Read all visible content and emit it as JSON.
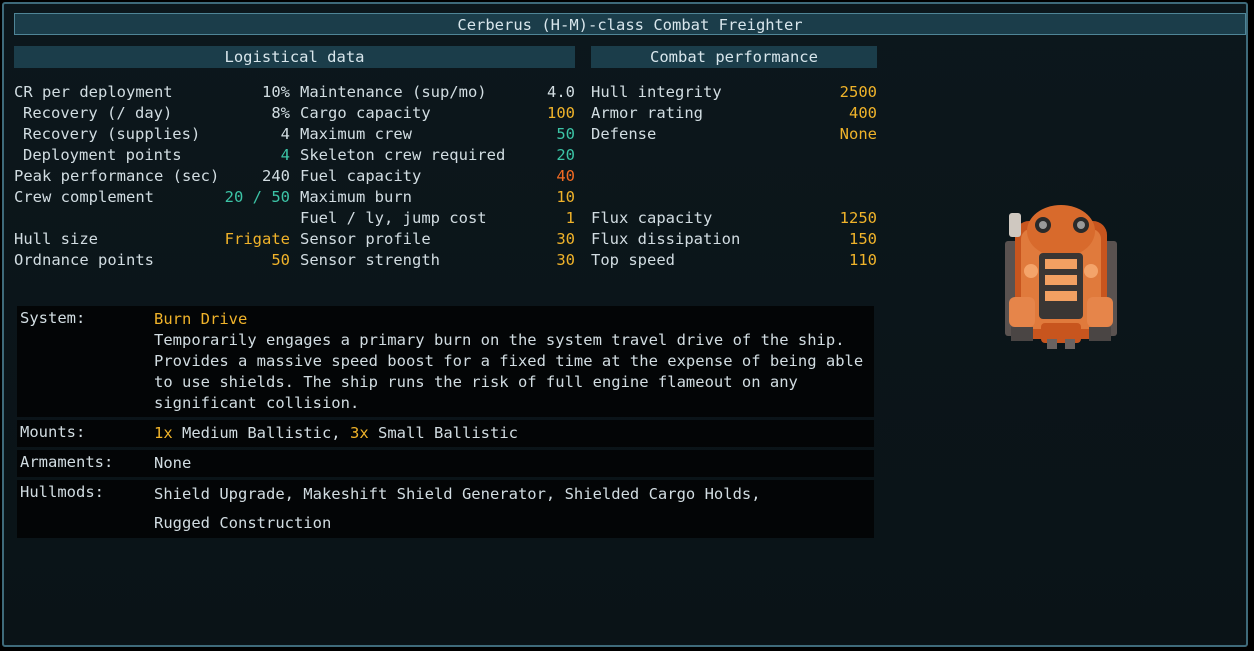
{
  "title": "Cerberus (H-M)-class Combat Freighter",
  "logistical_header": "Logistical data",
  "combat_header": "Combat performance",
  "col1": [
    {
      "label": "CR per deployment",
      "value": "10%",
      "color": "white",
      "indent": false
    },
    {
      "label": "Recovery (/ day)",
      "value": "8%",
      "color": "white",
      "indent": true
    },
    {
      "label": "Recovery (supplies)",
      "value": "4",
      "color": "white",
      "indent": true
    },
    {
      "label": "Deployment points",
      "value": "4",
      "color": "cyan",
      "indent": true
    },
    {
      "label": "Peak performance (sec)",
      "value": "240",
      "color": "white",
      "indent": false
    },
    {
      "label": "Crew complement",
      "value": "20 / 50",
      "color": "cyan",
      "indent": false
    },
    {
      "label": "",
      "value": "",
      "color": "white",
      "indent": false
    },
    {
      "label": "Hull size",
      "value": "Frigate",
      "color": "yellow",
      "indent": false
    },
    {
      "label": "Ordnance points",
      "value": "50",
      "color": "yellow",
      "indent": false
    }
  ],
  "col2": [
    {
      "label": "Maintenance (sup/mo)",
      "value": "4.0",
      "color": "white"
    },
    {
      "label": "Cargo capacity",
      "value": "100",
      "color": "yellow"
    },
    {
      "label": "Maximum crew",
      "value": "50",
      "color": "cyan"
    },
    {
      "label": "Skeleton crew required",
      "value": "20",
      "color": "cyan"
    },
    {
      "label": "Fuel capacity",
      "value": "40",
      "color": "orange"
    },
    {
      "label": "Maximum burn",
      "value": "10",
      "color": "yellow"
    },
    {
      "label": "Fuel / ly, jump cost",
      "value": "1",
      "color": "yellow"
    },
    {
      "label": "Sensor profile",
      "value": "30",
      "color": "yellow"
    },
    {
      "label": "Sensor strength",
      "value": "30",
      "color": "yellow"
    }
  ],
  "col3": [
    {
      "label": "Hull integrity",
      "value": "2500",
      "color": "yellow"
    },
    {
      "label": "Armor rating",
      "value": "400",
      "color": "yellow"
    },
    {
      "label": "Defense",
      "value": "None",
      "color": "yellow"
    },
    {
      "label": "",
      "value": "",
      "color": "white"
    },
    {
      "label": "",
      "value": "",
      "color": "white"
    },
    {
      "label": "",
      "value": "",
      "color": "white"
    },
    {
      "label": "Flux capacity",
      "value": "1250",
      "color": "yellow"
    },
    {
      "label": "Flux dissipation",
      "value": "150",
      "color": "yellow"
    },
    {
      "label": "Top speed",
      "value": "110",
      "color": "yellow"
    }
  ],
  "system": {
    "label": "System:",
    "name": "Burn Drive",
    "description": "Temporarily engages a primary burn on the system travel drive of the ship. Provides a massive speed boost for a fixed time at the expense of being able to use shields. The ship runs the risk of full engine flameout on any significant collision."
  },
  "mounts": {
    "label": "Mounts:",
    "count1": "1x",
    "type1": " Medium Ballistic,",
    "count2": "3x",
    "type2": " Small Ballistic"
  },
  "armaments": {
    "label": "Armaments:",
    "value": "None"
  },
  "hullmods": {
    "label": "Hullmods:",
    "line1": "Shield Upgrade, Makeshift Shield Generator, Shielded Cargo Holds,",
    "line2": "Rugged Construction"
  },
  "colors": {
    "yellow": "#f0b32a",
    "cyan": "#3cc4a6",
    "orange": "#f26b23",
    "header": "#1b3d4a"
  },
  "ship_icon": "ship-sprite"
}
